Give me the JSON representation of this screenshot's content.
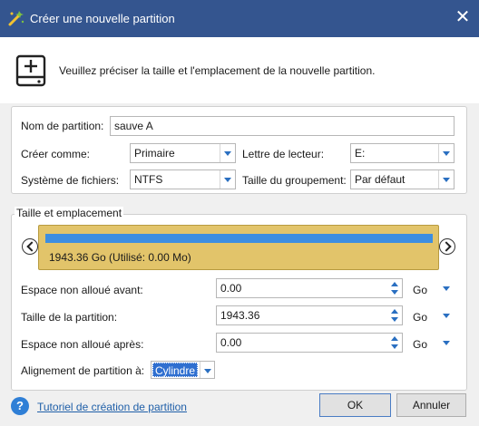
{
  "window": {
    "title": "Créer une nouvelle partition",
    "close_glyph": "✕",
    "app_icon": "minitool-wand-icon"
  },
  "header": {
    "icon": "disk-add-icon",
    "description": "Veuillez préciser la taille et l'emplacement de la nouvelle partition."
  },
  "settings": {
    "partition_name_label": "Nom de partition:",
    "partition_name_value": "sauve A",
    "create_as_label": "Créer comme:",
    "create_as_value": "Primaire",
    "drive_letter_label": "Lettre de lecteur:",
    "drive_letter_value": "E:",
    "filesystem_label": "Système de fichiers:",
    "filesystem_value": "NTFS",
    "cluster_size_label": "Taille du groupement:",
    "cluster_size_value": "Par défaut"
  },
  "size_location": {
    "legend": "Taille et emplacement",
    "bar_label": "1943.36 Go (Utilisé: 0.00 Mo)",
    "bar_used_fraction": 0,
    "unallocated_before_label": "Espace non alloué avant:",
    "unallocated_before_value": "0.00",
    "partition_size_label": "Taille de la partition:",
    "partition_size_value": "1943.36",
    "unallocated_after_label": "Espace non alloué après:",
    "unallocated_after_value": "0.00",
    "unit": "Go",
    "alignment_label": "Alignement de partition à:",
    "alignment_value": "Cylindre"
  },
  "footer": {
    "help_glyph": "?",
    "help_link": "Tutoriel de création de partition",
    "ok_label": "OK",
    "cancel_label": "Annuler"
  },
  "colors": {
    "titlebar": "#34558f",
    "bar_background": "#e2c46a",
    "bar_fill": "#3d8ee0",
    "accent": "#2a6fc1"
  }
}
